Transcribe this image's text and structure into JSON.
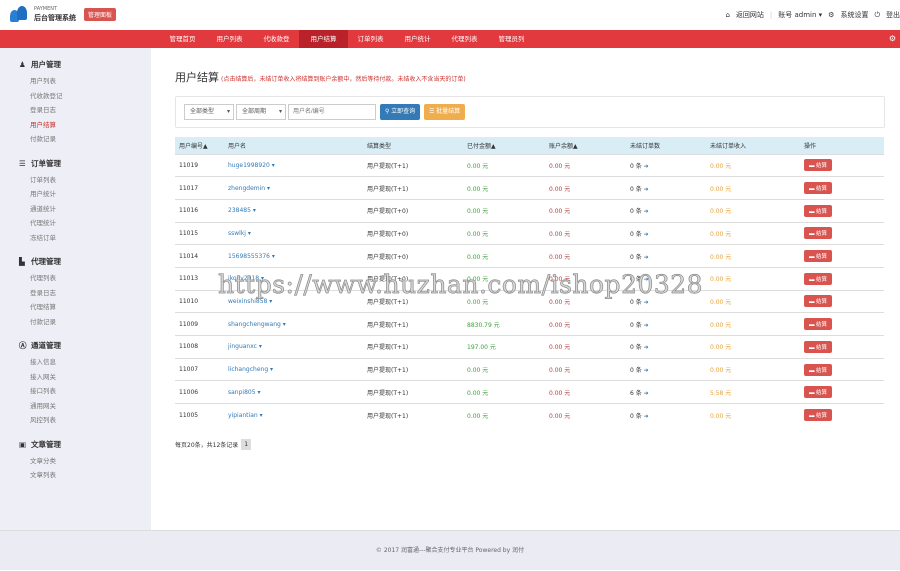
{
  "header": {
    "logo_small": "PAYMENT",
    "logo_title": "后台管理系统",
    "badge": "管理面板",
    "links": {
      "home": "返回网站",
      "account": "账号 admin",
      "settings": "系统设置",
      "logout": "登出"
    }
  },
  "nav": [
    "管理首页",
    "用户列表",
    "代收款登记",
    "用户结算",
    "订单列表",
    "用户统计",
    "代理列表",
    "管理员列表"
  ],
  "sidebar": [
    {
      "title": "用户管理",
      "items": [
        "用户列表",
        "代收款登记",
        "登录日志",
        "用户结算",
        "付款记录"
      ]
    },
    {
      "title": "订单管理",
      "items": [
        "订单列表",
        "用户统计",
        "通道统计",
        "代理统计",
        "冻结订单"
      ]
    },
    {
      "title": "代理管理",
      "items": [
        "代理列表",
        "登录日志",
        "代理结算",
        "付款记录"
      ]
    },
    {
      "title": "通道管理",
      "items": [
        "接入信息",
        "接入网关",
        "接口列表",
        "通用网关",
        "风控列表"
      ]
    },
    {
      "title": "文章管理",
      "items": [
        "文章分类",
        "文章列表"
      ]
    }
  ],
  "page": {
    "title": "用户结算",
    "note": "(点击结算后，未结订单收入将结算到账户余额中，然后等待付款。未结收入不含当天的订单)"
  },
  "filter": {
    "type": "全部类型",
    "period": "全部周期",
    "placeholder": "用户名/编号",
    "search": "立即查询",
    "batch": "批量结算"
  },
  "table": {
    "headers": [
      "用户编号▲",
      "用户名",
      "结算类型",
      "已付金额▲",
      "账户余额▲",
      "未结订单数",
      "未结订单收入",
      "操作"
    ],
    "rows": [
      [
        "11019",
        "huge1998920",
        "用户提现(T+1)",
        "0.00 元",
        "0.00 元",
        "0 条",
        "0.00 元",
        "结算"
      ],
      [
        "11017",
        "zhengdemin",
        "用户提现(T+1)",
        "0.00 元",
        "0.00 元",
        "0 条",
        "0.00 元",
        "结算"
      ],
      [
        "11016",
        "238485",
        "用户提现(T+0)",
        "0.00 元",
        "0.00 元",
        "0 条",
        "0.00 元",
        "结算"
      ],
      [
        "11015",
        "sswlkj",
        "用户提现(T+0)",
        "0.00 元",
        "0.00 元",
        "0 条",
        "0.00 元",
        "结算"
      ],
      [
        "11014",
        "15698555376",
        "用户提现(T+0)",
        "0.00 元",
        "0.00 元",
        "0 条",
        "0.00 元",
        "结算"
      ],
      [
        "11013",
        "jkoey2018",
        "用户提现(T+0)",
        "0.00 元",
        "0.00 元",
        "0 条",
        "0.00 元",
        "结算"
      ],
      [
        "11010",
        "weixinshi858",
        "用户提现(T+1)",
        "0.00 元",
        "0.00 元",
        "0 条",
        "0.00 元",
        "结算"
      ],
      [
        "11009",
        "shangchengwang",
        "用户提现(T+1)",
        "8830.79 元",
        "0.00 元",
        "0 条",
        "0.00 元",
        "结算"
      ],
      [
        "11008",
        "jinguanxc",
        "用户提现(T+1)",
        "197.00 元",
        "0.00 元",
        "0 条",
        "0.00 元",
        "结算"
      ],
      [
        "11007",
        "lichangcheng",
        "用户提现(T+1)",
        "0.00 元",
        "0.00 元",
        "0 条",
        "0.00 元",
        "结算"
      ],
      [
        "11006",
        "sanpi805",
        "用户提现(T+1)",
        "0.00 元",
        "0.00 元",
        "6 条",
        "5.58 元",
        "结算"
      ],
      [
        "11005",
        "yipiantian",
        "用户提现(T+1)",
        "0.00 元",
        "0.00 元",
        "0 条",
        "0.00 元",
        "结算"
      ]
    ]
  },
  "pager": {
    "summary": "每页20条，共12条记录",
    "page": "1"
  },
  "footer": "© 2017 润富通---聚合支付专业平台 Powered by 润付",
  "watermark": "https://www.huzhan.com/ishop20328"
}
